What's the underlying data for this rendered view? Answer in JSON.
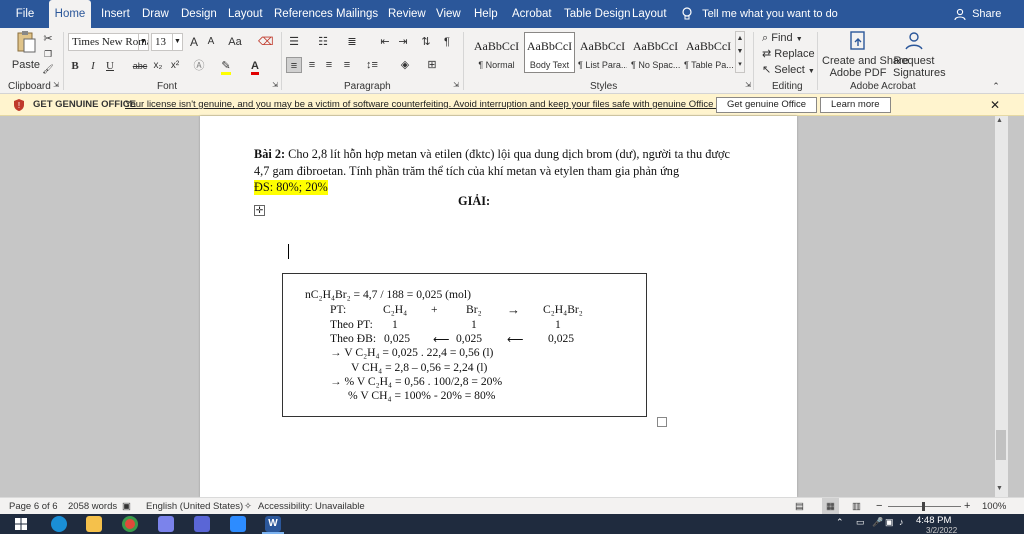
{
  "ribbon_tabs": [
    "File",
    "Home",
    "Insert",
    "Draw",
    "Design",
    "Layout",
    "References",
    "Mailings",
    "Review",
    "View",
    "Help",
    "Acrobat",
    "Table Design",
    "Layout"
  ],
  "active_tab": "Home",
  "tell_me": "Tell me what you want to do",
  "share": "Share",
  "clipboard": {
    "paste_label": "Paste",
    "group": "Clipboard"
  },
  "font": {
    "name": "Times New Roma",
    "size": "13",
    "group": "Font",
    "grow": "A",
    "shrink": "A",
    "case": "Aa",
    "bold": "B",
    "italic": "I",
    "underline": "U",
    "strike": "abc",
    "subscript": "x₂",
    "superscript": "x²"
  },
  "paragraph": {
    "group": "Paragraph"
  },
  "styles": {
    "group": "Styles",
    "items": [
      {
        "sample": "AaBbCcI",
        "name": "¶ Normal"
      },
      {
        "sample": "AaBbCcI",
        "name": "Body Text"
      },
      {
        "sample": "AaBbCcI",
        "name": "¶ List Para..."
      },
      {
        "sample": "AaBbCcI",
        "name": "¶ No Spac..."
      },
      {
        "sample": "AaBbCcI",
        "name": "¶ Table Pa..."
      }
    ]
  },
  "editing": {
    "group": "Editing",
    "find": "Find",
    "replace": "Replace",
    "select": "Select"
  },
  "acrobat": {
    "group": "Adobe Acrobat",
    "create_1": "Create and Share",
    "create_2": "Adobe PDF",
    "request_1": "Request",
    "request_2": "Signatures"
  },
  "message_bar": {
    "title": "GET GENUINE OFFICE",
    "text": "Your license isn't genuine, and you may be a victim of software counterfeiting. Avoid interruption and keep your files safe with genuine Office today.",
    "button1": "Get genuine Office",
    "button2": "Learn more"
  },
  "document": {
    "problem_label": "Bài 2:",
    "problem_line1": " Cho 2,8 lít hỗn hợp metan và etilen (đktc) lội qua dung dịch brom (dư), người ta thu được",
    "problem_line2": "4,7 gam đibroetan. Tính phần trăm thể tích của khí metan và etylen tham gia phản ứng",
    "answer": "ĐS: 80%; 20%",
    "solution_heading": "GIẢI:",
    "solution": {
      "l1": "nC₂H₄Br₂ = 4,7 / 188 = 0,025 (mol)",
      "pt_label": "PT:",
      "pt_c2h4": "C₂H₄",
      "pt_plus": "+",
      "pt_br2": "Br₂",
      "pt_arrow": "→",
      "pt_prod": "C₂H₄Br₂",
      "theo_pt": "Theo PT:",
      "pt_1a": "1",
      "pt_1b": "1",
      "pt_1c": "1",
      "theo_db": "Theo ĐB:",
      "db_a": "0,025",
      "db_arrow1": "⟵",
      "db_b": "0,025",
      "db_arrow2": "⟵",
      "db_c": "0,025",
      "v1": "→   V C₂H₄ = 0,025 . 22,4 = 0,56 (l)",
      "v2": "V CH₄ = 2,8 – 0,56  =  2,24  (l)",
      "p1": "→  %  V C₂H₄ = 0,56 . 100/2,8 = 20%",
      "p2": "%  V CH₄  = 100% - 20% = 80%"
    }
  },
  "status_bar": {
    "page": "Page 6 of 6",
    "words": "2058 words",
    "language": "English (United States)",
    "accessibility": "Accessibility: Unavailable",
    "zoom": "100%",
    "zoom_minus": "−",
    "zoom_plus": "+"
  },
  "taskbar": {
    "time": "4:48 PM",
    "date": "3/2/2022"
  },
  "colors": {
    "word_blue": "#2b579a",
    "highlight": "#ffff00",
    "message_bar": "#fff4ce"
  }
}
